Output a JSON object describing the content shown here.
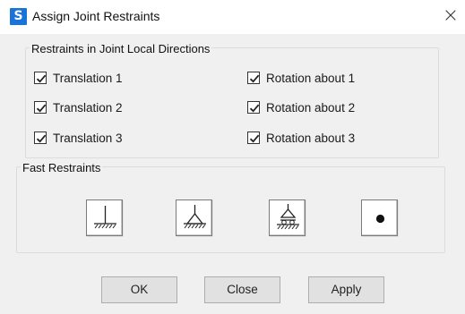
{
  "window": {
    "title": "Assign Joint Restraints",
    "app_icon_letter": "S",
    "close_glyph": "×"
  },
  "restraints_group": {
    "title": "Restraints in Joint Local Directions",
    "items": [
      {
        "label": "Translation 1",
        "checked": true
      },
      {
        "label": "Translation 2",
        "checked": true
      },
      {
        "label": "Translation 3",
        "checked": true
      },
      {
        "label": "Rotation about 1",
        "checked": true
      },
      {
        "label": "Rotation about 2",
        "checked": true
      },
      {
        "label": "Rotation about 3",
        "checked": true
      }
    ]
  },
  "fast_restraints": {
    "title": "Fast Restraints",
    "buttons": [
      {
        "icon": "fixed-support-icon"
      },
      {
        "icon": "pinned-support-icon"
      },
      {
        "icon": "roller-support-icon"
      },
      {
        "icon": "free-joint-icon"
      }
    ]
  },
  "buttons": {
    "ok": "OK",
    "close": "Close",
    "apply": "Apply"
  },
  "colors": {
    "app_icon": "#1a74d6",
    "client_bg": "#f0f0f0",
    "button_bg": "#e1e1e1"
  }
}
